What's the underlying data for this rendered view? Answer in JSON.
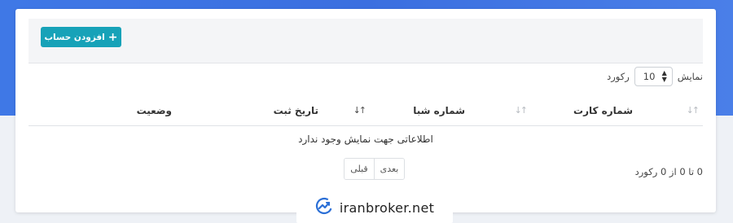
{
  "toolbar": {
    "add_button_label": "افزودن حساب",
    "add_icon": "plus-icon"
  },
  "length_menu": {
    "prefix": "نمایش",
    "selected": "10",
    "suffix": "رکورد"
  },
  "table": {
    "columns": [
      {
        "label": "شماره کارت",
        "sort_icon": "sort-icon",
        "sort_state": "none"
      },
      {
        "label": "شماره شبا",
        "sort_icon": "sort-icon",
        "sort_state": "none"
      },
      {
        "label": "تاریخ ثبت",
        "sort_icon": "sort-down-icon",
        "sort_state": "descending"
      },
      {
        "label": "وضعیت"
      }
    ],
    "rows": [],
    "empty_message": "اطلاعاتی جهت نمایش وجود ندارد"
  },
  "info": "0 تا 0 از 0 رکورد",
  "pagination": {
    "prev_label": "قبلی",
    "next_label": "بعدی"
  },
  "watermark": {
    "text": "iranbroker.net",
    "icon": "iranbroker-logo-icon"
  },
  "colors": {
    "header_gradient": "#3f78e6",
    "add_button": "#17a2b8",
    "watermark_icon": "#2b6fd6"
  }
}
